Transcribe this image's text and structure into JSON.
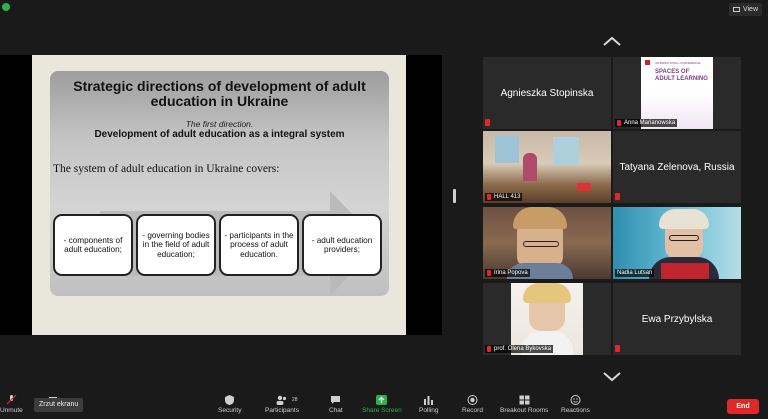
{
  "top": {
    "view_label": "View"
  },
  "slide": {
    "title": "Strategic directions of development of adult education in Ukraine",
    "subtitle": "The first direction.",
    "subtitle2": "Development of adult education as a integral system",
    "covers": "The system of adult education in Ukraine covers:",
    "boxes": [
      "- components of adult education;",
      "- governing bodies in the field of adult education;",
      "- participants in the process of adult education.",
      "- adult education providers;"
    ]
  },
  "gallery": {
    "participants": [
      {
        "name": "Agnieszka Stopinska",
        "muted": true,
        "video": false
      },
      {
        "name": "Anna Marianowska",
        "muted": true,
        "video": true
      },
      {
        "name": "HALL 413",
        "muted": true,
        "video": true
      },
      {
        "name": "Tatyana Zelenova, Russia",
        "muted": true,
        "video": false
      },
      {
        "name": "Irina Popova",
        "muted": true,
        "video": true
      },
      {
        "name": "Nadia Lutsan",
        "muted": false,
        "video": true
      },
      {
        "name": "prof. Olena Bykovska",
        "muted": true,
        "video": true
      },
      {
        "name": "Ewa Przybylska",
        "muted": true,
        "video": false
      }
    ],
    "conference_poster": {
      "line1": "INTERNATIONAL CONFERENCE",
      "line2": "SPACES OF",
      "line3": "ADULT LEARNING"
    }
  },
  "toolbar": {
    "unmute": "Unmute",
    "start_video": "Start Video",
    "tooltip": "Zrzut ekranu",
    "security": "Security",
    "participants": "Participants",
    "participants_count": "28",
    "chat": "Chat",
    "share_screen": "Share Screen",
    "polling": "Polling",
    "record": "Record",
    "breakout_rooms": "Breakout Rooms",
    "reactions": "Reactions",
    "end": "End"
  },
  "colors": {
    "end": "#e02828",
    "share_green": "#2bb24c",
    "active_speaker": "#9ee25a",
    "poster_purple": "#7a3d8f"
  }
}
